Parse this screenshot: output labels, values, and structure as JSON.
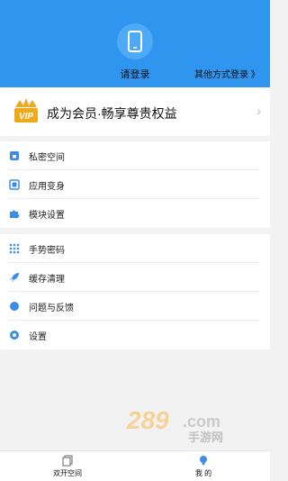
{
  "header": {
    "login_label": "请登录",
    "other_login_label": "其他方式登录 》",
    "bg_color": "#2f95ef"
  },
  "vip": {
    "badge_text": "VIP",
    "label": "成为会员·畅享尊贵权益",
    "chevron": "›"
  },
  "menu_group_1": [
    {
      "label": "私密空间",
      "icon": "lock-icon"
    },
    {
      "label": "应用变身",
      "icon": "app-disguise-icon"
    },
    {
      "label": "模块设置",
      "icon": "puzzle-icon"
    }
  ],
  "menu_group_2": [
    {
      "label": "手势密码",
      "icon": "gesture-grid-icon"
    },
    {
      "label": "缓存清理",
      "icon": "rocket-icon"
    },
    {
      "label": "问题与反馈",
      "icon": "feedback-icon"
    },
    {
      "label": "设置",
      "icon": "settings-icon"
    }
  ],
  "watermark": {
    "brand": "289.com",
    "subtitle": "手游网"
  },
  "tabbar": {
    "tabs": [
      {
        "label": "双开空间",
        "icon": "clone-space-icon"
      },
      {
        "label": "我 的",
        "icon": "profile-icon"
      }
    ]
  },
  "colors": {
    "accent": "#2f95ef",
    "icon_blue": "#3a8ee8",
    "vip_gold": "#f1a91c"
  }
}
